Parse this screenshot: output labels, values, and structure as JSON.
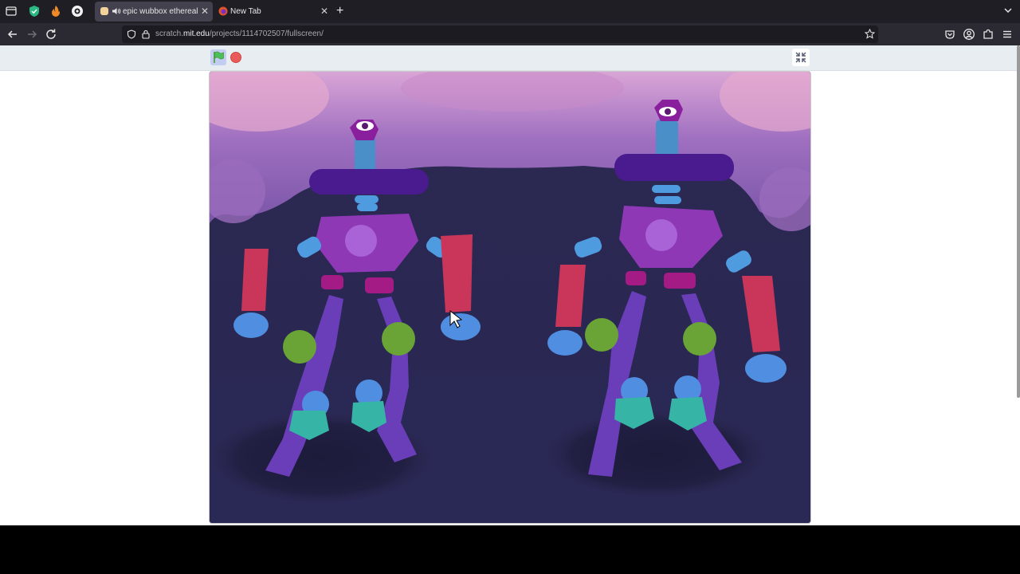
{
  "browser": {
    "tabs": [
      {
        "title": "epic wubbox ethereal is",
        "active": true
      },
      {
        "title": "New Tab",
        "active": false
      }
    ],
    "url_prefix": "scratch.",
    "url_domain": "mit.edu",
    "url_path": "/projects/1114702507/fullscreen/"
  },
  "icons": {
    "pinned": [
      "shield-check-icon",
      "flame-icon",
      "circle-logo-icon"
    ],
    "nav": [
      "back-icon",
      "forward-icon",
      "reload-icon"
    ],
    "toolbar": [
      "pocket-icon",
      "account-icon",
      "extensions-icon",
      "menu-icon"
    ]
  },
  "scratch": {
    "controls": [
      "green-flag-icon",
      "stop-icon",
      "exit-fullscreen-icon"
    ]
  },
  "colors": {
    "tabbar": "#1f1e25",
    "navbar": "#2b2a33",
    "stage_bg": "#2a2850",
    "flag": "#4cbf56",
    "stop": "#ec5959"
  }
}
